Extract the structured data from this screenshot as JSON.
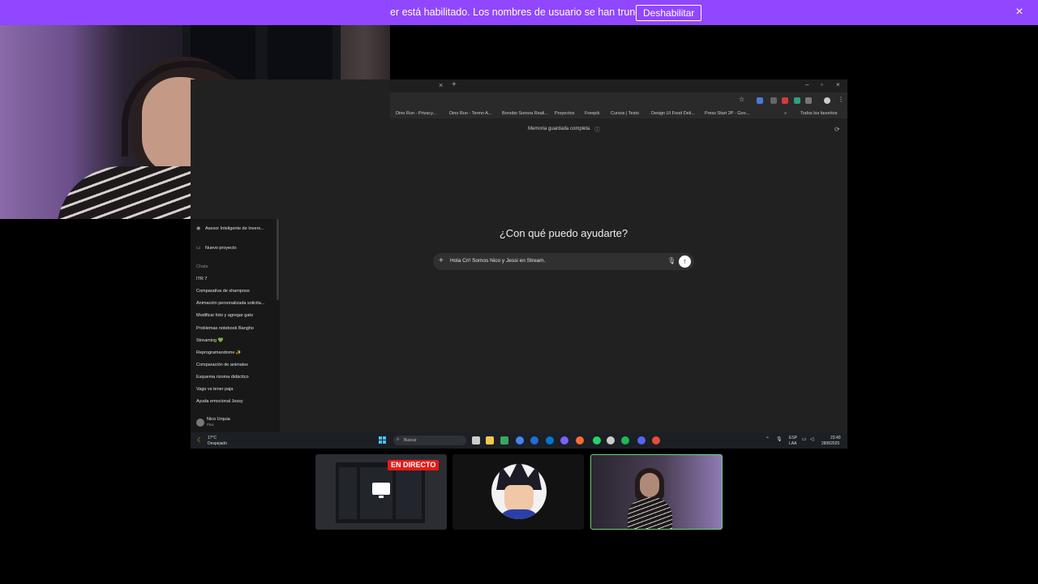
{
  "banner": {
    "message": "er está habilitado. Los nombres de usuario se han truncado.",
    "button_label": "Deshabilitar",
    "close_icon": "×",
    "color": "#9146ff"
  },
  "browser": {
    "tab_close": "×",
    "new_tab": "+",
    "window_controls": [
      "–",
      "▫",
      "×"
    ],
    "toolbar_icons": [
      "star-icon",
      "extensions-icon",
      "profile-icon",
      "menu-icon"
    ],
    "bookmarks": [
      "Dino Run - Privacy...",
      "Dino Run - Termn A...",
      "Bonobo Sonora Reali...",
      "Proyectos",
      "Freepik",
      "Cursos | Testo",
      "Design UI Food Deli...",
      "Press Start 2P · Goo..."
    ],
    "bookmarks_overflow": "»",
    "all_bookmarks": "Todos los favoritos"
  },
  "chat": {
    "memory_status": "Memoria guardada completa",
    "memory_icon": "ⓘ",
    "greeting": "¿Con qué puedo ayudarte?",
    "composer_plus": "+",
    "composer_text": "Hola Cri! Somos Nico y Jessi en Stream.",
    "mic_icon": "🎙",
    "send_icon": "↑"
  },
  "sidebar": {
    "gpt_name": "Asesor Inteligente de Invers...",
    "new_project": "Nuevo proyecto",
    "chats_header": "Chats",
    "chats": [
      "ITR 7",
      "Comparativa de shampoos",
      "Animación personalizada solicita...",
      "Modificar foto y agregar gato",
      "Problemas notebook Bangho",
      "Streaming 💚",
      "Reprogramandome ✨",
      "Comparación de animales",
      "Esquema rizoma didáctico",
      "Vago vs tener paja",
      "Ayuda emocional Jessy"
    ],
    "user_name": "Nico Urquia",
    "user_plan": "Plus"
  },
  "taskbar": {
    "weather_temp": "17°C",
    "weather_desc": "Despejado",
    "search_placeholder": "Buscar",
    "lang_top": "ESP",
    "lang_bottom": "LAA",
    "time": "23:40",
    "date": "28/8/2025",
    "app_colors": [
      "#cccccc",
      "#f2c94c",
      "#3ba55d",
      "#4285f4",
      "#1e6fd9",
      "#0078d4",
      "#7b61ff",
      "#ff6b35",
      "#25d366",
      "#cccccc",
      "#1db954",
      "#5865f2",
      "#e74c3c"
    ]
  },
  "participants": {
    "live_badge": "EN DIRECTO"
  }
}
